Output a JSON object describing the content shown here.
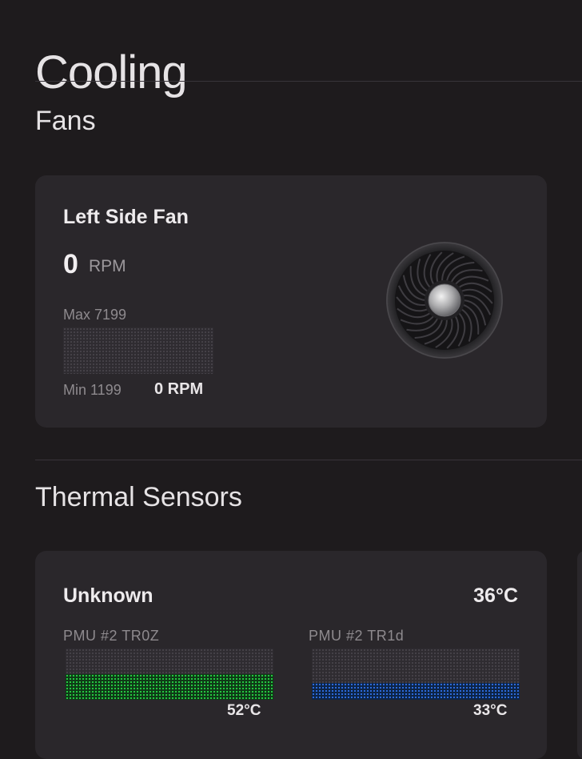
{
  "page": {
    "title": "Cooling"
  },
  "fans": {
    "section_title": "Fans",
    "items": [
      {
        "name": "Left Side Fan",
        "rpm": "0",
        "rpm_unit": "RPM",
        "max_label": "Max 7199",
        "min_label": "Min 1199",
        "current_label": "0 RPM",
        "fill_fraction": 0
      }
    ]
  },
  "thermal": {
    "section_title": "Thermal Sensors",
    "cards": [
      {
        "name": "Unknown",
        "temp": "36°C",
        "sensors": [
          {
            "label": "PMU #2 TR0Z",
            "temp": "52°C",
            "fill_fraction": 0.5,
            "color": "#26d443"
          },
          {
            "label": "PMU #2 TR1d",
            "temp": "33°C",
            "fill_fraction": 0.33,
            "color": "#2f6fe6"
          }
        ]
      }
    ]
  }
}
